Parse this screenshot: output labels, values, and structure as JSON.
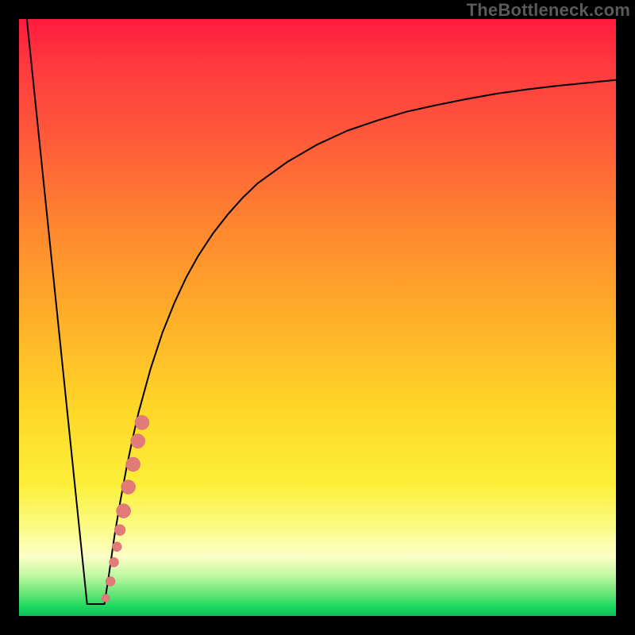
{
  "watermark": "TheBottleneck.com",
  "colors": {
    "frame": "#000000",
    "curve": "#000000",
    "dot_fill": "#e17a78",
    "dot_stroke": "#d86b68",
    "gradient_top": "#ff1b3d",
    "gradient_bottom": "#0bbf57"
  },
  "chart_data": {
    "type": "line",
    "title": "",
    "xlabel": "",
    "ylabel": "",
    "xlim": [
      0,
      100
    ],
    "ylim": [
      0,
      100
    ],
    "grid": false,
    "legend": "none",
    "series": [
      {
        "name": "bottleneck-curve",
        "description": "Black V-shaped curve: steep linear drop from top-left into a trough, then asymptotic rise toward top-right.",
        "left_segment": {
          "x": [
            1.3,
            11.4
          ],
          "y": [
            100,
            2.0
          ]
        },
        "trough": {
          "x": [
            11.4,
            14.3
          ],
          "y": [
            2.0,
            2.0
          ]
        },
        "right_segment_samples": {
          "x": [
            14.3,
            15,
            16,
            17,
            18,
            19,
            20,
            22,
            24,
            26,
            28,
            30,
            32.5,
            35,
            37.5,
            40,
            45,
            50,
            55,
            60,
            65,
            70,
            75,
            80,
            85,
            90,
            95,
            100
          ],
          "y": [
            2.0,
            6.5,
            13.5,
            19.4,
            24.8,
            29.6,
            34.0,
            41.3,
            47.4,
            52.4,
            56.7,
            60.3,
            64.1,
            67.3,
            70.1,
            72.5,
            76.1,
            79.0,
            81.3,
            83.0,
            84.5,
            85.6,
            86.6,
            87.5,
            88.2,
            88.8,
            89.3,
            89.8
          ]
        }
      }
    ],
    "points": {
      "name": "highlight-dots",
      "description": "Salmon-pink dots clustered along the lower-right wall of the trough.",
      "coords": [
        {
          "x": 14.5,
          "y": 3.0,
          "r": 5
        },
        {
          "x": 15.3,
          "y": 5.8,
          "r": 6
        },
        {
          "x": 15.9,
          "y": 9.0,
          "r": 6
        },
        {
          "x": 16.4,
          "y": 11.6,
          "r": 6
        },
        {
          "x": 16.9,
          "y": 14.4,
          "r": 7
        },
        {
          "x": 17.5,
          "y": 17.6,
          "r": 9
        },
        {
          "x": 18.3,
          "y": 21.6,
          "r": 9
        },
        {
          "x": 19.1,
          "y": 25.4,
          "r": 9
        },
        {
          "x": 19.9,
          "y": 29.3,
          "r": 9
        },
        {
          "x": 20.6,
          "y": 32.4,
          "r": 9
        }
      ]
    }
  }
}
